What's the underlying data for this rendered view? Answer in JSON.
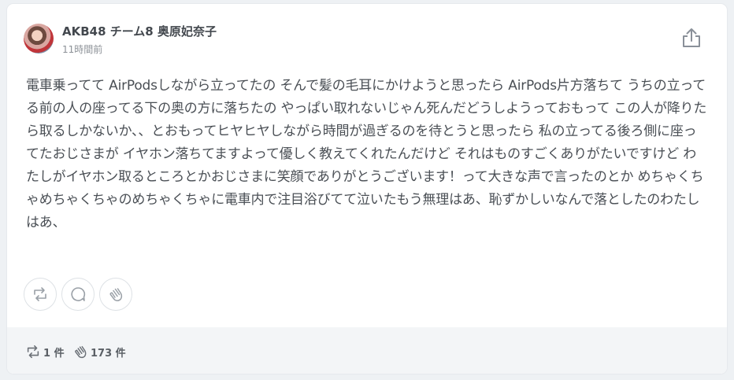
{
  "post": {
    "author": "AKB48 チーム8 奥原妃奈子",
    "time": "11時間前",
    "body": "電車乗ってて AirPodsしながら立ってたの そんで髪の毛耳にかけようと思ったら AirPods片方落ちて うちの立ってる前の人の座ってる下の奥の方に落ちたの やっぱい取れないじゃん死んだどうしようっておもって この人が降りたら取るしかないか、、とおもってヒヤヒヤしながら時間が過ぎるのを待とうと思ったら 私の立ってる後ろ側に座ってたおじさまが イヤホン落ちてますよって優しく教えてくれたんだけど それはものすごくありがたいですけど わたしがイヤホン取るところとかおじさまに笑顔でありがとうございます！って大きな声で言ったのとか めちゃくちゃめちゃくちゃのめちゃくちゃに電車内で注目浴びてて泣いたもう無理はあ、恥ずかしいなんで落としたのわたし はあ、"
  },
  "icons": {
    "share": "share-icon",
    "repost": "repost-icon",
    "comment": "comment-icon",
    "clap": "clap-icon"
  },
  "stats": {
    "repost_count": "1 件",
    "clap_count": "173 件"
  },
  "colors": {
    "text": "#4a4f55",
    "muted": "#8c9197",
    "icon": "#8a9099",
    "footer_bg": "#f3f5f7",
    "page_bg": "#eef1f4"
  }
}
